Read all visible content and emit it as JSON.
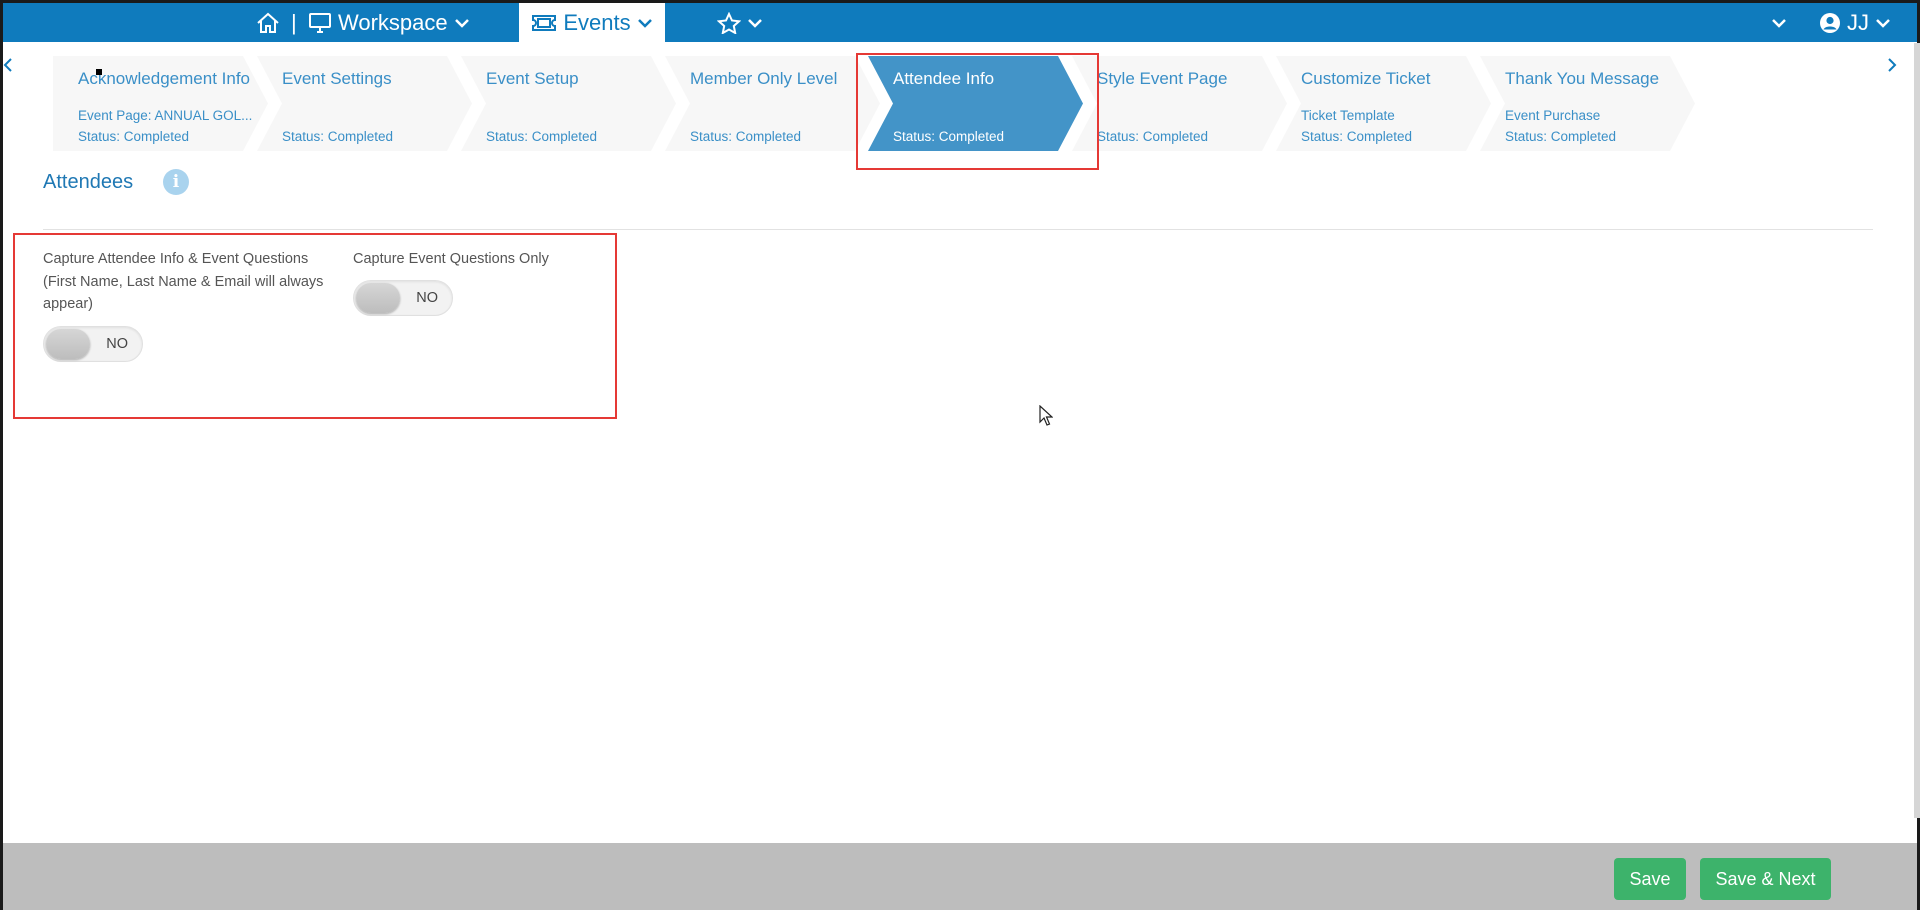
{
  "topnav": {
    "separator": "|",
    "workspace_label": "Workspace",
    "events_label": "Events",
    "user_initials": "JJ"
  },
  "steps": [
    {
      "title": "Acknowledgement Info",
      "sub": "Event Page: ANNUAL GOL...",
      "status": "Status: Completed"
    },
    {
      "title": "Event Settings",
      "sub": "",
      "status": "Status: Completed"
    },
    {
      "title": "Event Setup",
      "sub": "",
      "status": "Status: Completed"
    },
    {
      "title": "Member Only Level",
      "sub": "",
      "status": "Status: Completed"
    },
    {
      "title": "Attendee Info",
      "sub": "",
      "status": "Status: Completed"
    },
    {
      "title": "Style Event Page",
      "sub": "",
      "status": "Status: Completed"
    },
    {
      "title": "Customize Ticket",
      "sub": "Ticket Template",
      "status": "Status: Completed"
    },
    {
      "title": "Thank You Message",
      "sub": "Event Purchase",
      "status": "Status: Completed"
    }
  ],
  "section": {
    "title": "Attendees",
    "info_glyph": "i"
  },
  "fields": {
    "capture_all": {
      "label": "Capture Attendee Info & Event Questions (First Name, Last Name & Email will always appear)",
      "value": "NO"
    },
    "capture_questions": {
      "label": "Capture Event Questions Only",
      "value": "NO"
    }
  },
  "footer": {
    "save_label": "Save",
    "save_next_label": "Save & Next"
  },
  "colors": {
    "nav_blue": "#0f7bbd",
    "active_step": "#4394c8",
    "button_green": "#3db36b",
    "highlight_red": "#e53935"
  },
  "icons": {
    "home": "home-icon",
    "workspace": "monitor-icon",
    "events": "ticket-icon",
    "favorites": "star-icon",
    "user": "user-circle-icon"
  }
}
